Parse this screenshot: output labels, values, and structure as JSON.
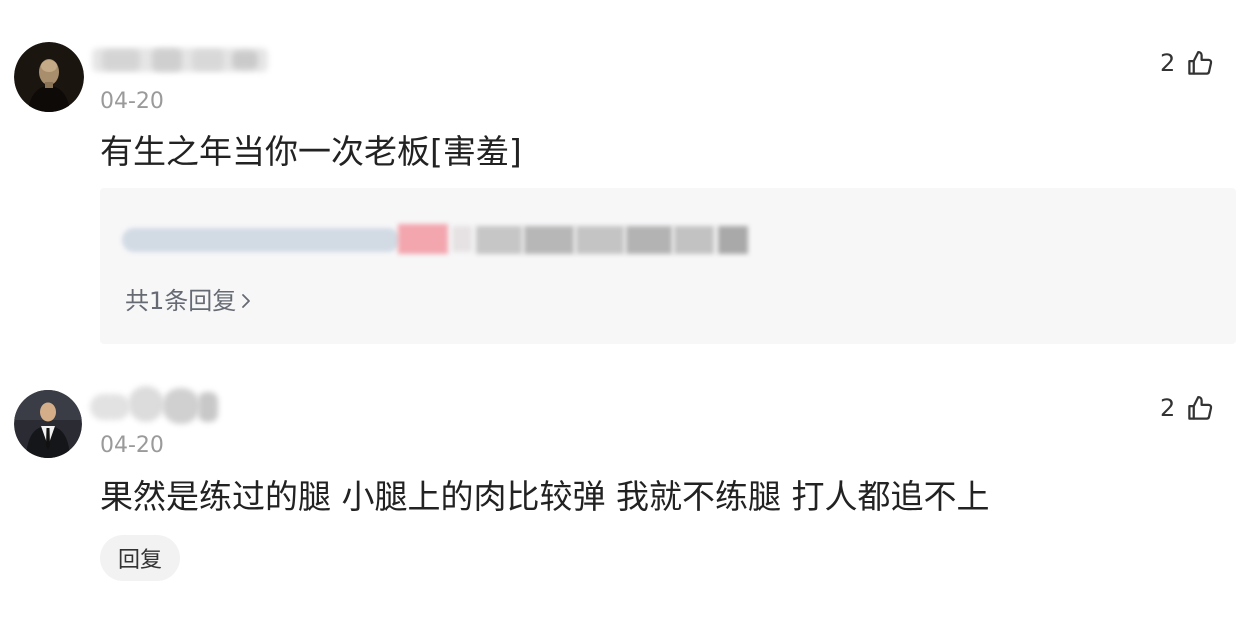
{
  "comments": [
    {
      "date": "04-20",
      "likes": "2",
      "text": "有生之年当你一次老板[害羞]",
      "reply_summary": "共1条回复"
    },
    {
      "date": "04-20",
      "likes": "2",
      "text": "果然是练过的腿 小腿上的肉比较弹 我就不练腿 打人都追不上",
      "reply_button": "回复"
    }
  ],
  "icons": {
    "like": "thumbs-up-icon",
    "reply_chevron": "chevron-right-icon",
    "avatar": "user-avatar"
  },
  "colors": {
    "text": "#222222",
    "muted": "#9a9a9a",
    "reply_link": "#666a73",
    "reply_box_bg": "#f7f7f8",
    "reply_button_bg": "#f2f2f3"
  }
}
